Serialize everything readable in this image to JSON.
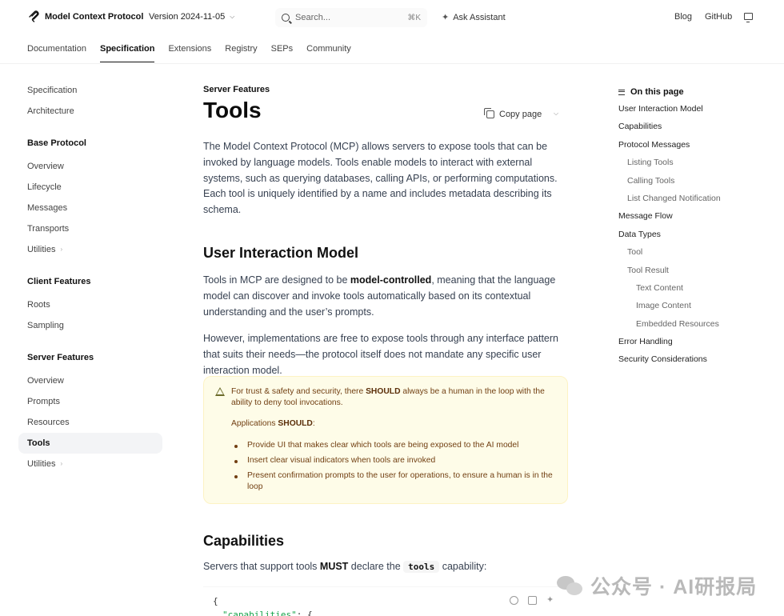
{
  "topbar": {
    "logo_text": "Model Context Protocol",
    "version": "Version 2024-11-05",
    "search_placeholder": "Search...",
    "search_shortcut": "⌘K",
    "ask_assistant": "Ask Assistant",
    "blog": "Blog",
    "github": "GitHub"
  },
  "tabs": [
    {
      "label": "Documentation"
    },
    {
      "label": "Specification"
    },
    {
      "label": "Extensions"
    },
    {
      "label": "Registry"
    },
    {
      "label": "SEPs"
    },
    {
      "label": "Community"
    }
  ],
  "sidebar": {
    "top_items": [
      "Specification",
      "Architecture"
    ],
    "base_protocol": {
      "heading": "Base Protocol",
      "items": [
        "Overview",
        "Lifecycle",
        "Messages",
        "Transports",
        "Utilities"
      ]
    },
    "client_features": {
      "heading": "Client Features",
      "items": [
        "Roots",
        "Sampling"
      ]
    },
    "server_features": {
      "heading": "Server Features",
      "items": [
        "Overview",
        "Prompts",
        "Resources",
        "Tools",
        "Utilities"
      ]
    }
  },
  "main": {
    "eyebrow": "Server Features",
    "title": "Tools",
    "copy_page": "Copy page",
    "intro": "The Model Context Protocol (MCP) allows servers to expose tools that can be invoked by language models. Tools enable models to interact with external systems, such as querying databases, calling APIs, or performing computations. Each tool is uniquely identified by a name and includes metadata describing its schema.",
    "h2_user_interaction": "User Interaction Model",
    "p1_before": "Tools in MCP are designed to be ",
    "p1_bold": "model-controlled",
    "p1_after": ", meaning that the language model can discover and invoke tools automatically based on its contextual understanding and the user’s prompts.",
    "p2": "However, implementations are free to expose tools through any interface pattern that suits their needs—the protocol itself does not mandate any specific user interaction model.",
    "callout": {
      "line1_before": "For trust & safety and security, there ",
      "line1_bold": "SHOULD",
      "line1_after": " always be a human in the loop with the ability to deny tool invocations.",
      "apps_before": "Applications ",
      "apps_bold": "SHOULD",
      "apps_after": ":",
      "bullets": [
        "Provide UI that makes clear which tools are being exposed to the AI model",
        "Insert clear visual indicators when tools are invoked",
        "Present confirmation prompts to the user for operations, to ensure a human is in the loop"
      ]
    },
    "h2_capabilities": "Capabilities",
    "cap_before": "Servers that support tools ",
    "cap_bold": "MUST",
    "cap_mid": " declare the ",
    "cap_code": "tools",
    "cap_after": " capability:",
    "code_line1": "{",
    "code_key": "\"capabilities\"",
    "code_rest": ": {"
  },
  "toc": {
    "heading": "On this page",
    "items": [
      {
        "label": "User Interaction Model",
        "level": 1
      },
      {
        "label": "Capabilities",
        "level": 1
      },
      {
        "label": "Protocol Messages",
        "level": 1
      },
      {
        "label": "Listing Tools",
        "level": 2
      },
      {
        "label": "Calling Tools",
        "level": 2
      },
      {
        "label": "List Changed Notification",
        "level": 2
      },
      {
        "label": "Message Flow",
        "level": 1
      },
      {
        "label": "Data Types",
        "level": 1
      },
      {
        "label": "Tool",
        "level": 2
      },
      {
        "label": "Tool Result",
        "level": 2
      },
      {
        "label": "Text Content",
        "level": 3
      },
      {
        "label": "Image Content",
        "level": 3
      },
      {
        "label": "Embedded Resources",
        "level": 3
      },
      {
        "label": "Error Handling",
        "level": 1
      },
      {
        "label": "Security Considerations",
        "level": 1
      }
    ]
  },
  "watermark": {
    "text": "公众号 · AI研报局"
  },
  "colors": {
    "callout_bg": "#fefce8",
    "callout_text": "#713f12",
    "code_key": "#16a34a"
  }
}
